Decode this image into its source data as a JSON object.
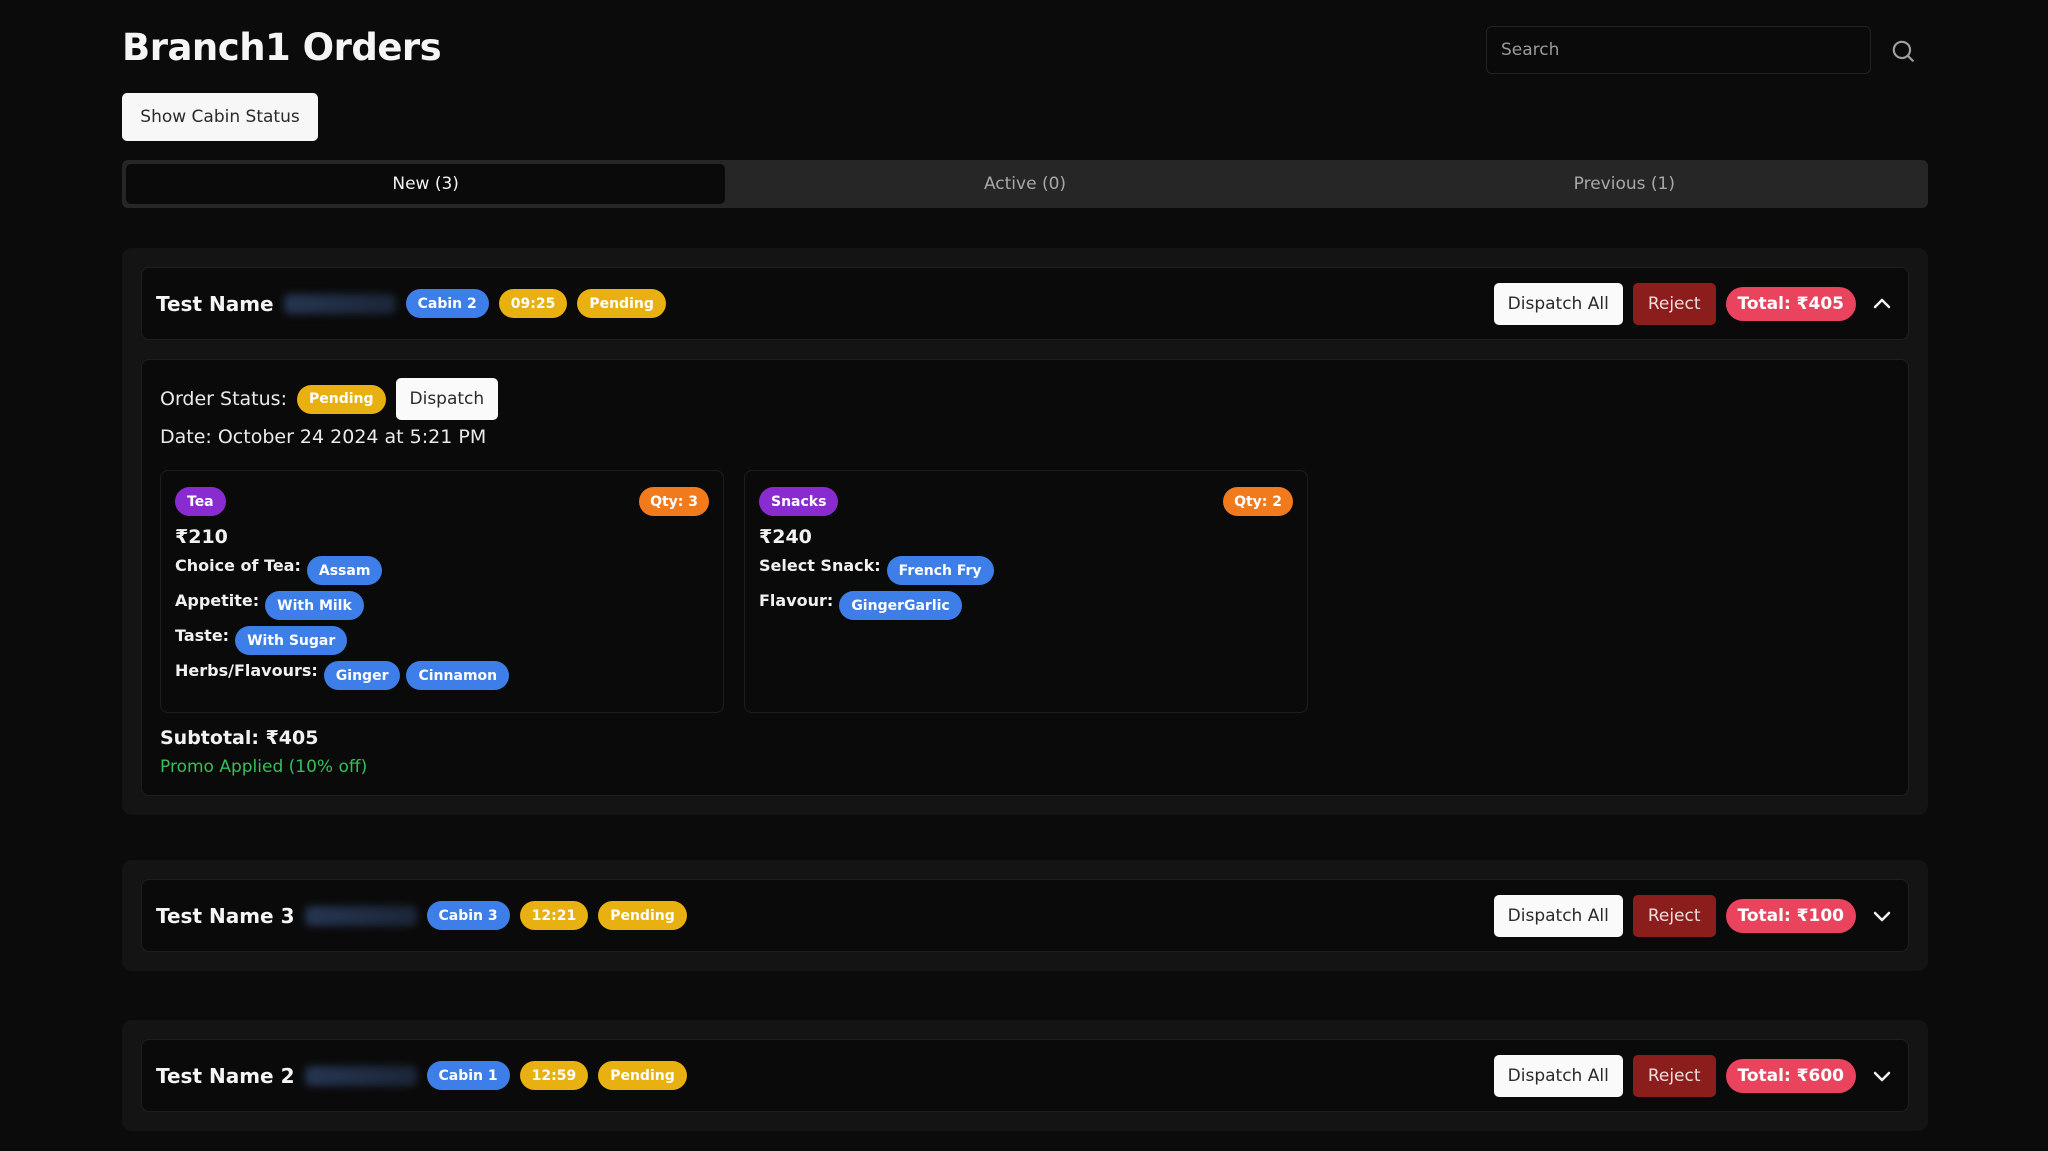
{
  "header": {
    "title": "Branch1 Orders",
    "cabin_status_button": "Show Cabin Status",
    "search_placeholder": "Search",
    "search_icon": "search-icon"
  },
  "tabs": [
    {
      "label": "New (3)",
      "active": true
    },
    {
      "label": "Active (0)",
      "active": false
    },
    {
      "label": "Previous (1)",
      "active": false
    }
  ],
  "colors": {
    "cabin_badge": "#3d7ee8",
    "time_badge": "#e8b010",
    "status_badge": "#e8b010",
    "total_badge": "#e9435e",
    "reject_button": "#8b1d1d",
    "category_badge": "#8a2bd0",
    "qty_badge": "#f07a1c",
    "option_badge": "#3d7ee8",
    "promo_text": "#33c05a"
  },
  "orders": [
    {
      "customer": "Test Name",
      "phone_blurred": true,
      "cabin": "Cabin 2",
      "time": "09:25",
      "status": "Pending",
      "dispatch_all_label": "Dispatch All",
      "reject_label": "Reject",
      "total": "Total: ₹405",
      "expanded": true,
      "toggle_icon": "chevron-up-icon",
      "details": {
        "order_status_label": "Order Status:",
        "order_status": "Pending",
        "dispatch_label": "Dispatch",
        "date": "Date: October 24 2024 at 5:21 PM",
        "items": [
          {
            "category": "Tea",
            "qty": "Qty: 3",
            "price": "₹210",
            "options": [
              {
                "label": "Choice of Tea:",
                "values": [
                  "Assam"
                ]
              },
              {
                "label": "Appetite:",
                "values": [
                  "With Milk"
                ]
              },
              {
                "label": "Taste:",
                "values": [
                  "With Sugar"
                ]
              },
              {
                "label": "Herbs/Flavours:",
                "values": [
                  "Ginger",
                  "Cinnamon"
                ]
              }
            ]
          },
          {
            "category": "Snacks",
            "qty": "Qty: 2",
            "price": "₹240",
            "options": [
              {
                "label": "Select Snack:",
                "values": [
                  "French Fry"
                ]
              },
              {
                "label": "Flavour:",
                "values": [
                  "GingerGarlic"
                ]
              }
            ]
          }
        ],
        "subtotal": "Subtotal: ₹405",
        "promo": "Promo Applied (10% off)"
      }
    },
    {
      "customer": "Test Name 3",
      "phone_blurred": true,
      "cabin": "Cabin 3",
      "time": "12:21",
      "status": "Pending",
      "dispatch_all_label": "Dispatch All",
      "reject_label": "Reject",
      "total": "Total: ₹100",
      "expanded": false,
      "toggle_icon": "chevron-down-icon"
    },
    {
      "customer": "Test Name 2",
      "phone_blurred": true,
      "cabin": "Cabin 1",
      "time": "12:59",
      "status": "Pending",
      "dispatch_all_label": "Dispatch All",
      "reject_label": "Reject",
      "total": "Total: ₹600",
      "expanded": false,
      "toggle_icon": "chevron-down-icon"
    }
  ]
}
